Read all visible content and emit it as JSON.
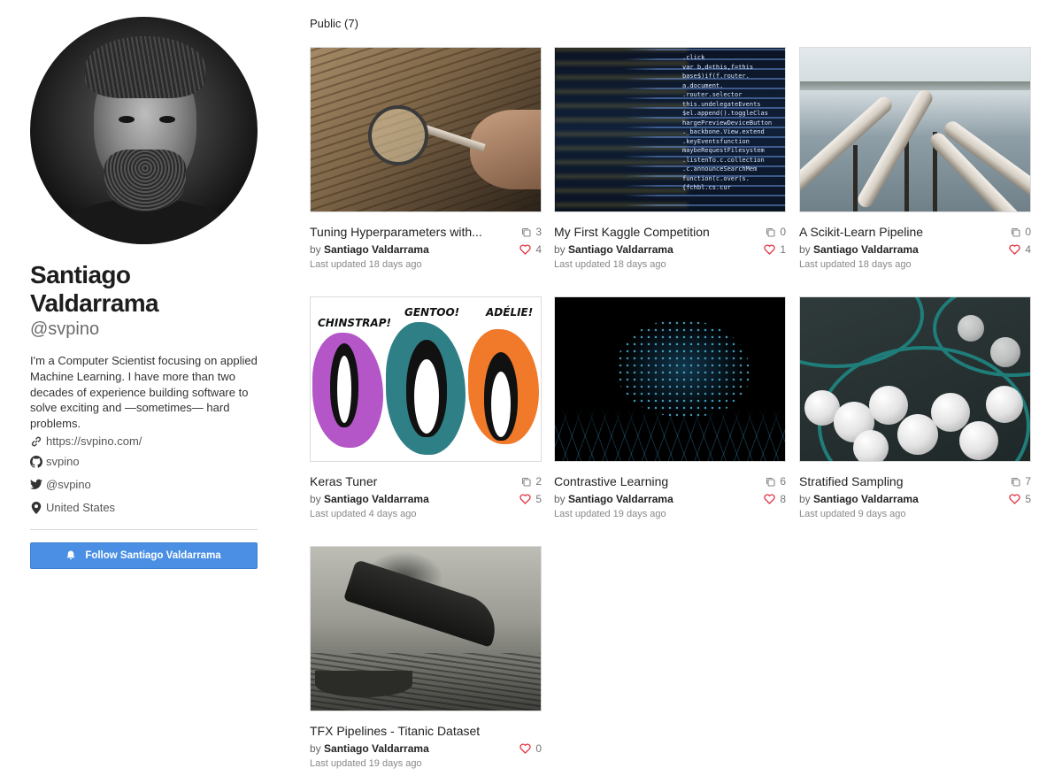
{
  "profile": {
    "name": "Santiago Valdarrama",
    "handle": "@svpino",
    "bio": "I'm a Computer Scientist focusing on applied Machine Learning. I have more than two decades of experience building software to solve exciting and —sometimes— hard problems.",
    "website": "https://svpino.com/",
    "github": "svpino",
    "twitter": "@svpino",
    "location": "United States",
    "follow_label": "Follow Santiago Valdarrama"
  },
  "section": {
    "label": "Public (7)"
  },
  "colors": {
    "accent": "#4a8fe4",
    "heart": "#e0323f"
  },
  "notebooks": [
    {
      "title": "Tuning Hyperparameters with...",
      "by_prefix": "by",
      "author": "Santiago Valdarrama",
      "updated": "Last updated 18 days ago",
      "copies": "3",
      "likes": "4",
      "thumb_icon": "magnifying-glass-image"
    },
    {
      "title": "My First Kaggle Competition",
      "by_prefix": "by",
      "author": "Santiago Valdarrama",
      "updated": "Last updated 18 days ago",
      "copies": "0",
      "likes": "1",
      "thumb_icon": "source-code-image"
    },
    {
      "title": "A Scikit-Learn Pipeline",
      "by_prefix": "by",
      "author": "Santiago Valdarrama",
      "updated": "Last updated 18 days ago",
      "copies": "0",
      "likes": "4",
      "thumb_icon": "pipes-image"
    },
    {
      "title": "Keras Tuner",
      "by_prefix": "by",
      "author": "Santiago Valdarrama",
      "updated": "Last updated 4 days ago",
      "copies": "2",
      "likes": "5",
      "thumb_icon": "penguins-image"
    },
    {
      "title": "Contrastive Learning",
      "by_prefix": "by",
      "author": "Santiago Valdarrama",
      "updated": "Last updated 19 days ago",
      "copies": "6",
      "likes": "8",
      "thumb_icon": "brain-network-image"
    },
    {
      "title": "Stratified Sampling",
      "by_prefix": "by",
      "author": "Santiago Valdarrama",
      "updated": "Last updated 9 days ago",
      "copies": "7",
      "likes": "5",
      "thumb_icon": "golf-balls-image"
    },
    {
      "title": "TFX Pipelines - Titanic Dataset",
      "by_prefix": "by",
      "author": "Santiago Valdarrama",
      "updated": "Last updated 19 days ago",
      "copies": "",
      "likes": "0",
      "thumb_icon": "titanic-image"
    }
  ],
  "penguin_labels": [
    "CHINSTRAP!",
    "GENTOO!",
    "ADÉLIE!"
  ],
  "code_lines": [
    ".click",
    "var b,d=this,f=this",
    "base$)if(f.router.",
    "a.document.",
    ".router.selector",
    "this.undelegateEvents",
    "$el.append().toggleClas",
    "hargePreviewDeviceButton",
    "._backbone.View.extend",
    ".keyEventsfunction",
    "maybeRequestFilesystem",
    ".listenTo.c.collection",
    ".c.announceSearchMem",
    "function(c.over(s.",
    "{fchbl.cs.cur"
  ]
}
